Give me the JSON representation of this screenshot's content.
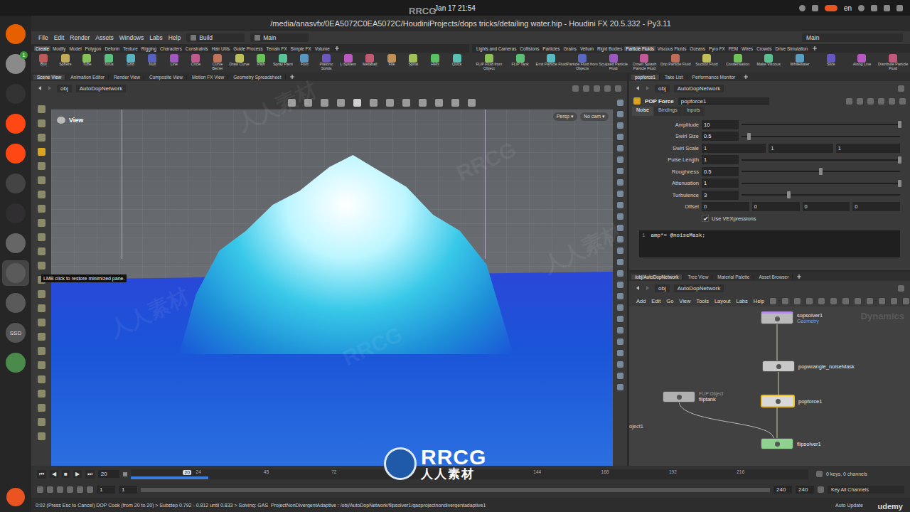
{
  "topbar": {
    "clock": "Jan 17  21:54",
    "input_source": "en"
  },
  "dock": {
    "apps": [
      {
        "kind": "firefox",
        "selected": false
      },
      {
        "kind": "files",
        "selected": false,
        "badge": "1"
      },
      {
        "kind": "terminal",
        "selected": false
      },
      {
        "kind": "houdini",
        "selected": false
      },
      {
        "kind": "houdini",
        "selected": false
      },
      {
        "kind": "monitor",
        "selected": false
      },
      {
        "kind": "obs",
        "selected": false
      },
      {
        "kind": "disc",
        "selected": false
      },
      {
        "kind": "gear",
        "selected": true
      },
      {
        "kind": "gear",
        "selected": false
      },
      {
        "kind": "ssd",
        "selected": false,
        "label": "SSD"
      },
      {
        "kind": "trash",
        "selected": false
      }
    ]
  },
  "window": {
    "title": "/media/anasvfx/0EA5072C0EA5072C/HoudiniProjects/dops tricks/detailing water.hip - Houdini FX 20.5.332 - Py3.11"
  },
  "menu": [
    "File",
    "Edit",
    "Render",
    "Assets",
    "Windows",
    "Labs",
    "Help"
  ],
  "desktop": {
    "build": "Build",
    "main": "Main",
    "right": "Main"
  },
  "shelf_left": {
    "tabs": [
      {
        "label": "Create",
        "selected": true
      },
      {
        "label": "Modify",
        "selected": false
      },
      {
        "label": "Model",
        "selected": false
      },
      {
        "label": "Polygon",
        "selected": false
      },
      {
        "label": "Deform",
        "selected": false
      },
      {
        "label": "Texture",
        "selected": false
      },
      {
        "label": "Rigging",
        "selected": false
      },
      {
        "label": "Characters",
        "selected": false
      },
      {
        "label": "Constraints",
        "selected": false
      },
      {
        "label": "Hair Utils",
        "selected": false
      },
      {
        "label": "Guide Process",
        "selected": false
      },
      {
        "label": "Terrain FX",
        "selected": false
      },
      {
        "label": "Simple FX",
        "selected": false
      },
      {
        "label": "Volume",
        "selected": false
      }
    ],
    "tools": [
      "Box",
      "Sphere",
      "Tube",
      "Torus",
      "Grid",
      "Null",
      "Line",
      "Circle",
      "Curve Bezier",
      "Draw Curve",
      "Path",
      "Spray Paint",
      "Font",
      "Platonic Solids",
      "L-System",
      "Metaball",
      "File",
      "Spiral",
      "Helix",
      "Quick"
    ]
  },
  "shelf_right": {
    "tabs": [
      {
        "label": "Lights and Cameras",
        "selected": false
      },
      {
        "label": "Collisions",
        "selected": false
      },
      {
        "label": "Particles",
        "selected": false
      },
      {
        "label": "Grains",
        "selected": false
      },
      {
        "label": "Vellum",
        "selected": false
      },
      {
        "label": "Rigid Bodies",
        "selected": false
      },
      {
        "label": "Particle Fluids",
        "selected": true
      },
      {
        "label": "Viscous Fluids",
        "selected": false
      },
      {
        "label": "Oceans",
        "selected": false
      },
      {
        "label": "Pyro FX",
        "selected": false
      },
      {
        "label": "FEM",
        "selected": false
      },
      {
        "label": "Wires",
        "selected": false
      },
      {
        "label": "Crowds",
        "selected": false
      },
      {
        "label": "Drive Simulation",
        "selected": false
      }
    ],
    "tools": [
      "FLIP Fluid from Object",
      "FLIP Tank",
      "Emit Particle Fluid",
      "Particle Fluid from Objects",
      "Sculpted Particle Fluid",
      "Crown Splash Particle Fluid",
      "Drip Particle Fluid",
      "Suction Fluid",
      "Condensation",
      "Make Viscous",
      "Whitewater",
      "Slice",
      "Along Line",
      "Distribute Particle Fluid"
    ]
  },
  "pane_tabs": [
    {
      "label": "Scene View",
      "selected": true
    },
    {
      "label": "Animation Editor",
      "selected": false
    },
    {
      "label": "Render View",
      "selected": false
    },
    {
      "label": "Composite View",
      "selected": false
    },
    {
      "label": "Motion FX View",
      "selected": false
    },
    {
      "label": "Geometry Spreadsheet",
      "selected": false
    }
  ],
  "path": [
    "obj",
    "AutoDopNetwork"
  ],
  "viewport": {
    "label": "View",
    "camera_menus": [
      "Persp ▾",
      "No cam ▾"
    ],
    "tooltip": "LMB click to restore minimized pane."
  },
  "params": {
    "tabs": [
      {
        "label": "popforce1",
        "selected": true
      },
      {
        "label": "Take List",
        "selected": false
      },
      {
        "label": "Performance Monitor",
        "selected": false
      }
    ],
    "path": [
      "obj",
      "AutoDopNetwork"
    ],
    "node_type": "POP Force",
    "node_name": "popforce1",
    "subtabs": [
      {
        "label": "Noise",
        "selected": true
      },
      {
        "label": "Bindings",
        "selected": false
      },
      {
        "label": "Inputs",
        "selected": false
      }
    ],
    "rows": [
      {
        "kind": "slider",
        "label": "Amplitude",
        "value": "10",
        "level": 1
      },
      {
        "kind": "slider",
        "label": "Swirl Size",
        "value": "0.5",
        "level": 0.05
      },
      {
        "kind": "vector",
        "label": "Swirl Scale",
        "values": [
          "1",
          "1",
          "1"
        ]
      },
      {
        "kind": "slider",
        "label": "Pulse Length",
        "value": "1",
        "level": 1
      },
      {
        "kind": "slider",
        "label": "Roughness",
        "value": "0.5",
        "level": 0.5
      },
      {
        "kind": "slider",
        "label": "Attenuation",
        "value": "1",
        "level": 1
      },
      {
        "kind": "slider",
        "label": "Turbulence",
        "value": "3",
        "level": 0.3
      },
      {
        "kind": "vector",
        "label": "Offset",
        "values": [
          "0",
          "0",
          "0",
          "0"
        ]
      }
    ],
    "checkbox": {
      "label": "Use VEXpressions",
      "checked": true
    },
    "code": [
      {
        "line": "1",
        "text": "amp*= @noiseMask;"
      }
    ]
  },
  "network": {
    "tabs": [
      {
        "label": "/obj/AutoDopNetwork",
        "selected": true
      },
      {
        "label": "Tree View",
        "selected": false
      },
      {
        "label": "Material Palette",
        "selected": false
      },
      {
        "label": "Asset Browser",
        "selected": false
      }
    ],
    "path": [
      "obj",
      "AutoDopNetwork"
    ],
    "menu": [
      "Add",
      "Edit",
      "Go",
      "View",
      "Tools",
      "Layout",
      "Labs",
      "Help"
    ],
    "context": "Dynamics",
    "nodes": [
      {
        "name": "sopsolver1",
        "kind": "solver",
        "sub": "Geometry",
        "color": "#b9b9b9",
        "selected": false
      },
      {
        "name": "popwrangle_noiseMask",
        "kind": "node",
        "color": "#c8c8c8",
        "selected": false
      },
      {
        "name": "popforce1",
        "kind": "node",
        "color": "#d8d8d8",
        "selected": true
      },
      {
        "name": "fliptank",
        "kind": "object",
        "type": "FLIP Object",
        "color": "#b0b0b0",
        "selected": false
      },
      {
        "name": "flipsolver1",
        "kind": "node",
        "color": "#8fd18f",
        "selected": false
      },
      {
        "name": "oject1",
        "kind": "label",
        "color": "#cccccc",
        "selected": false
      }
    ]
  },
  "timeline": {
    "buttons": [
      "⏮",
      "◀",
      "■",
      "▶",
      "⏭"
    ],
    "frame": "20",
    "ticks": [
      "24",
      "48",
      "72",
      "144",
      "168",
      "192",
      "216"
    ],
    "start_frames": [
      "1",
      "1"
    ],
    "end_frames": [
      "240",
      "240"
    ],
    "keys": "0 keys, 0 channels",
    "key_all": "Key All Channels",
    "cache_level": 0.115
  },
  "status": {
    "message": "0:02 (Press Esc to Cancel) DOP Cook (from 20 to 20) > Substep 0.792 - 0.812 until 0.833 > Solving: GAS_ProjectNonDivergentAdaptive : /obj/AutoDopNetwork/flipsolver1/gasprojectnondivergentadaptive1",
    "auto_update": "Auto Update"
  },
  "watermarks": {
    "top": "RRCG",
    "logo_main": "RRCG",
    "logo_sub": "人人素材",
    "course": "udemy",
    "faint": [
      "人人素材",
      "RRCG",
      "人人素材",
      "RRCG",
      "人人素材"
    ]
  }
}
